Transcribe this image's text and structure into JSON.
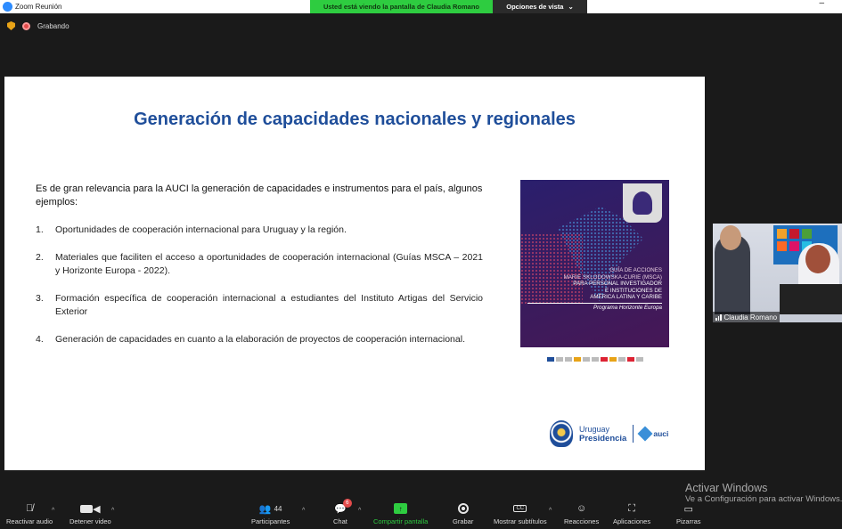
{
  "window": {
    "title": "Zoom Reunión",
    "minimize": "–"
  },
  "share_banner": {
    "text": "Usted está viendo la pantalla de Claudia Romano",
    "view_options": "Opciones de vista",
    "view_options_caret": "⌄"
  },
  "status": {
    "recording_label": "Grabando"
  },
  "slide": {
    "title": "Generación de capacidades nacionales y regionales",
    "intro": "Es de gran relevancia para la AUCI la generación de capacidades e instrumentos para el país, algunos ejemplos:",
    "items": [
      {
        "num": "1.",
        "text": "Oportunidades de cooperación internacional para Uruguay y la región."
      },
      {
        "num": "2.",
        "text": "Materiales que faciliten el acceso a oportunidades de cooperación internacional (Guías MSCA – 2021 y Horizonte Europa - 2022)."
      },
      {
        "num": "3.",
        "text": "Formación específica de cooperación internacional a estudiantes del Instituto Artigas del Servicio Exterior"
      },
      {
        "num": "4.",
        "text": "Generación de capacidades en cuanto a la elaboración de proyectos de cooperación internacional."
      }
    ],
    "cover": {
      "line1": "GUÍA DE ACCIONES",
      "line2": "MARIE SKLODOWSKA-CURIE (MSCA)",
      "line3": "PARA PERSONAL INVESTIGADOR",
      "line4": "E INSTITUCIONES DE",
      "line5": "AMÉRICA LATINA Y CARIBE",
      "line6": "Programa Horizonte Europa"
    },
    "logo": {
      "country": "Uruguay",
      "presidency": "Presidencia",
      "agency": "auci"
    }
  },
  "video": {
    "participant_name": "Claudia Romano"
  },
  "watermark": {
    "line1": "Activar Windows",
    "line2": "Ve a Configuración para activar Windows."
  },
  "toolbar": {
    "audio": "Reactivar audio",
    "video": "Detener video",
    "participants": "Participantes",
    "participants_count": "44",
    "chat": "Chat",
    "chat_badge": "6",
    "share": "Compartir pantalla",
    "record": "Grabar",
    "subtitles": "Mostrar subtítulos",
    "subtitles_icon": "CC",
    "reactions": "Reacciones",
    "apps": "Aplicaciones",
    "whiteboards": "Pizarras"
  },
  "colors": {
    "zoom_blue": "#2d8cff",
    "share_green": "#2ecc40",
    "title_blue": "#1f4e9a",
    "alert_red": "#e34b4b"
  }
}
